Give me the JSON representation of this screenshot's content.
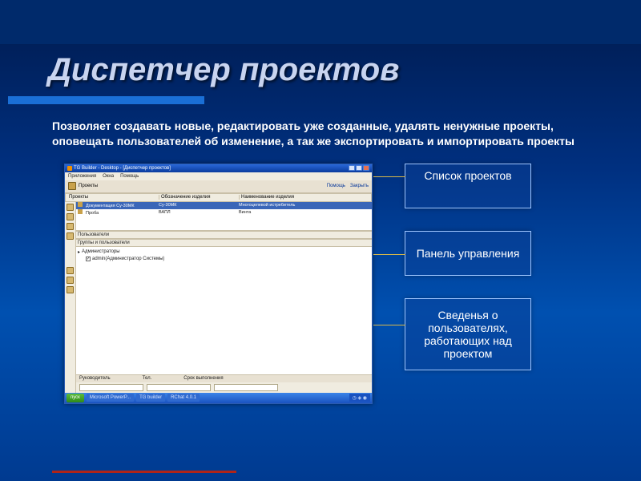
{
  "slide": {
    "title": "Диспетчер проектов",
    "description": "Позволяет создавать новые, редактировать уже созданные, удалять ненужные проекты, оповещать пользователей об изменение, а так же экспортировать и импортировать проекты"
  },
  "callouts": {
    "c1": "Список проектов",
    "c2": "Панель управления",
    "c3": "Сведенья о пользователях, работающих над проектом"
  },
  "app_window": {
    "title": "TG Builder - Desktop - [Диспетчер проектов]",
    "menu": {
      "m1": "Приложения",
      "m2": "Окна",
      "m3": "Помощь"
    },
    "toolbar_label": "Проекты",
    "toolbar_right": {
      "help": "Помощь",
      "close": "Закрыть"
    },
    "columns": {
      "c1": "Проекты",
      "c2": "Обозначение изделия",
      "c3": "Наименование изделия"
    },
    "rows": {
      "r1": {
        "name": "Документация Су-30МК",
        "code": "Су-30МК",
        "product": "Многоцелевой истребитель"
      },
      "r2": {
        "name": "Проба",
        "code": "ВАПЛ",
        "product": "Винта"
      }
    },
    "sections": {
      "users_hdr1": "Пользователи",
      "users_hdr2": "Группы и пользователи"
    },
    "users": {
      "u1": "Администраторы",
      "u2": "admin(Администратор Системы)"
    },
    "form": {
      "f1": "Руководитель",
      "f2": "Тел.",
      "f3": "Срок выполнения"
    },
    "taskbar": {
      "start": "пуск",
      "t1": "Microsoft PowerP...",
      "t2": "TG builder",
      "t3": "RChat 4.0.1"
    }
  }
}
